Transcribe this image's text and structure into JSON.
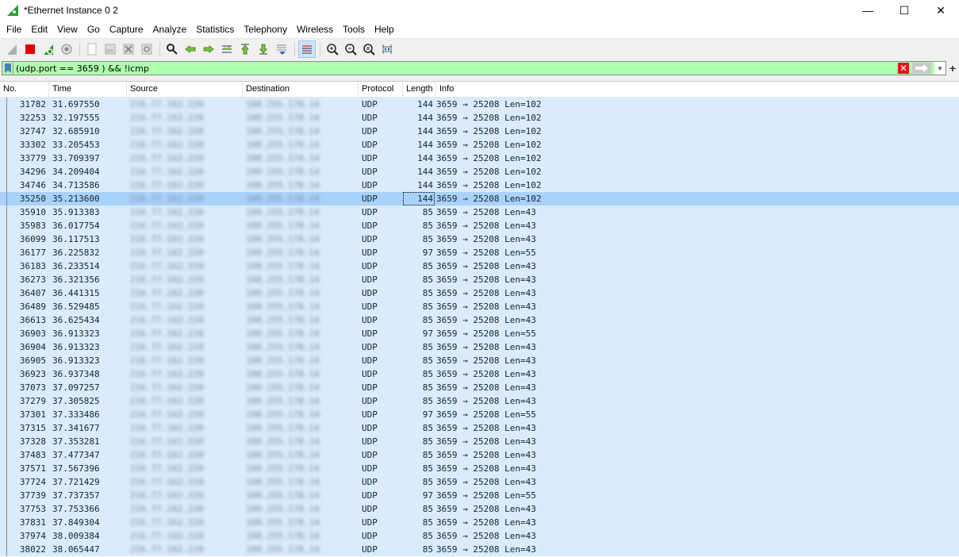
{
  "window": {
    "title": "*Ethernet Instance 0 2",
    "controls": {
      "minimize": "—",
      "maximize": "☐",
      "close": "✕"
    }
  },
  "menu": [
    "File",
    "Edit",
    "View",
    "Go",
    "Capture",
    "Analyze",
    "Statistics",
    "Telephony",
    "Wireless",
    "Tools",
    "Help"
  ],
  "toolbar": {
    "icons": [
      "shark-fin-start-icon",
      "stop-capture-icon",
      "restart-capture-icon",
      "capture-options-icon",
      "open-file-icon",
      "save-file-icon",
      "close-file-icon",
      "reload-file-icon",
      "find-packet-icon",
      "go-back-icon",
      "go-forward-icon",
      "go-to-packet-icon",
      "go-first-icon",
      "go-last-icon",
      "autoscroll-icon",
      "colorize-icon",
      "zoom-in-icon",
      "zoom-out-icon",
      "zoom-normal-icon",
      "resize-columns-icon"
    ]
  },
  "filter": {
    "value": "(udp.port == 3659 ) && !icmp",
    "valid_color": "#afffaf"
  },
  "columns": [
    "No.",
    "Time",
    "Source",
    "Destination",
    "Protocol",
    "Length",
    "Info"
  ],
  "selected_row_no": "35250",
  "packets": [
    {
      "no": "31782",
      "time": "31.697550",
      "src": "216.77.162.220",
      "dst": "100.255.178.14",
      "proto": "UDP",
      "len": "144",
      "info": "3659 → 25208 Len=102"
    },
    {
      "no": "32253",
      "time": "32.197555",
      "src": "216.77.162.220",
      "dst": "100.255.178.14",
      "proto": "UDP",
      "len": "144",
      "info": "3659 → 25208 Len=102"
    },
    {
      "no": "32747",
      "time": "32.685910",
      "src": "216.77.162.220",
      "dst": "100.255.178.14",
      "proto": "UDP",
      "len": "144",
      "info": "3659 → 25208 Len=102"
    },
    {
      "no": "33302",
      "time": "33.205453",
      "src": "216.77.162.220",
      "dst": "100.255.178.14",
      "proto": "UDP",
      "len": "144",
      "info": "3659 → 25208 Len=102"
    },
    {
      "no": "33779",
      "time": "33.709397",
      "src": "216.77.162.220",
      "dst": "100.255.178.14",
      "proto": "UDP",
      "len": "144",
      "info": "3659 → 25208 Len=102"
    },
    {
      "no": "34296",
      "time": "34.209404",
      "src": "216.77.162.220",
      "dst": "100.255.178.14",
      "proto": "UDP",
      "len": "144",
      "info": "3659 → 25208 Len=102"
    },
    {
      "no": "34746",
      "time": "34.713586",
      "src": "216.77.162.220",
      "dst": "100.255.178.14",
      "proto": "UDP",
      "len": "144",
      "info": "3659 → 25208 Len=102"
    },
    {
      "no": "35250",
      "time": "35.213600",
      "src": "216.77.162.220",
      "dst": "100.255.178.14",
      "proto": "UDP",
      "len": "144",
      "info": "3659 → 25208 Len=102"
    },
    {
      "no": "35910",
      "time": "35.913383",
      "src": "216.77.162.220",
      "dst": "100.255.178.14",
      "proto": "UDP",
      "len": "85",
      "info": "3659 → 25208 Len=43"
    },
    {
      "no": "35983",
      "time": "36.017754",
      "src": "216.77.162.220",
      "dst": "100.255.178.14",
      "proto": "UDP",
      "len": "85",
      "info": "3659 → 25208 Len=43"
    },
    {
      "no": "36099",
      "time": "36.117513",
      "src": "216.77.162.220",
      "dst": "100.255.178.14",
      "proto": "UDP",
      "len": "85",
      "info": "3659 → 25208 Len=43"
    },
    {
      "no": "36177",
      "time": "36.225832",
      "src": "216.77.162.220",
      "dst": "100.255.178.14",
      "proto": "UDP",
      "len": "97",
      "info": "3659 → 25208 Len=55"
    },
    {
      "no": "36183",
      "time": "36.233514",
      "src": "216.77.162.220",
      "dst": "100.255.178.14",
      "proto": "UDP",
      "len": "85",
      "info": "3659 → 25208 Len=43"
    },
    {
      "no": "36273",
      "time": "36.321356",
      "src": "216.77.162.220",
      "dst": "100.255.178.14",
      "proto": "UDP",
      "len": "85",
      "info": "3659 → 25208 Len=43"
    },
    {
      "no": "36407",
      "time": "36.441315",
      "src": "216.77.162.220",
      "dst": "100.255.178.14",
      "proto": "UDP",
      "len": "85",
      "info": "3659 → 25208 Len=43"
    },
    {
      "no": "36489",
      "time": "36.529485",
      "src": "216.77.162.220",
      "dst": "100.255.178.14",
      "proto": "UDP",
      "len": "85",
      "info": "3659 → 25208 Len=43"
    },
    {
      "no": "36613",
      "time": "36.625434",
      "src": "216.77.162.220",
      "dst": "100.255.178.14",
      "proto": "UDP",
      "len": "85",
      "info": "3659 → 25208 Len=43"
    },
    {
      "no": "36903",
      "time": "36.913323",
      "src": "216.77.162.220",
      "dst": "100.255.178.14",
      "proto": "UDP",
      "len": "97",
      "info": "3659 → 25208 Len=55"
    },
    {
      "no": "36904",
      "time": "36.913323",
      "src": "216.77.162.220",
      "dst": "100.255.178.14",
      "proto": "UDP",
      "len": "85",
      "info": "3659 → 25208 Len=43"
    },
    {
      "no": "36905",
      "time": "36.913323",
      "src": "216.77.162.220",
      "dst": "100.255.178.14",
      "proto": "UDP",
      "len": "85",
      "info": "3659 → 25208 Len=43"
    },
    {
      "no": "36923",
      "time": "36.937348",
      "src": "216.77.162.220",
      "dst": "100.255.178.14",
      "proto": "UDP",
      "len": "85",
      "info": "3659 → 25208 Len=43"
    },
    {
      "no": "37073",
      "time": "37.097257",
      "src": "216.77.162.220",
      "dst": "100.255.178.14",
      "proto": "UDP",
      "len": "85",
      "info": "3659 → 25208 Len=43"
    },
    {
      "no": "37279",
      "time": "37.305825",
      "src": "216.77.162.220",
      "dst": "100.255.178.14",
      "proto": "UDP",
      "len": "85",
      "info": "3659 → 25208 Len=43"
    },
    {
      "no": "37301",
      "time": "37.333486",
      "src": "216.77.162.220",
      "dst": "100.255.178.14",
      "proto": "UDP",
      "len": "97",
      "info": "3659 → 25208 Len=55"
    },
    {
      "no": "37315",
      "time": "37.341677",
      "src": "216.77.162.220",
      "dst": "100.255.178.14",
      "proto": "UDP",
      "len": "85",
      "info": "3659 → 25208 Len=43"
    },
    {
      "no": "37328",
      "time": "37.353281",
      "src": "216.77.162.220",
      "dst": "100.255.178.14",
      "proto": "UDP",
      "len": "85",
      "info": "3659 → 25208 Len=43"
    },
    {
      "no": "37483",
      "time": "37.477347",
      "src": "216.77.162.220",
      "dst": "100.255.178.14",
      "proto": "UDP",
      "len": "85",
      "info": "3659 → 25208 Len=43"
    },
    {
      "no": "37571",
      "time": "37.567396",
      "src": "216.77.162.220",
      "dst": "100.255.178.14",
      "proto": "UDP",
      "len": "85",
      "info": "3659 → 25208 Len=43"
    },
    {
      "no": "37724",
      "time": "37.721429",
      "src": "216.77.162.220",
      "dst": "100.255.178.14",
      "proto": "UDP",
      "len": "85",
      "info": "3659 → 25208 Len=43"
    },
    {
      "no": "37739",
      "time": "37.737357",
      "src": "216.77.162.220",
      "dst": "100.255.178.14",
      "proto": "UDP",
      "len": "97",
      "info": "3659 → 25208 Len=55"
    },
    {
      "no": "37753",
      "time": "37.753366",
      "src": "216.77.162.220",
      "dst": "100.255.178.14",
      "proto": "UDP",
      "len": "85",
      "info": "3659 → 25208 Len=43"
    },
    {
      "no": "37831",
      "time": "37.849304",
      "src": "216.77.162.220",
      "dst": "100.255.178.14",
      "proto": "UDP",
      "len": "85",
      "info": "3659 → 25208 Len=43"
    },
    {
      "no": "37974",
      "time": "38.009384",
      "src": "216.77.162.220",
      "dst": "100.255.178.14",
      "proto": "UDP",
      "len": "85",
      "info": "3659 → 25208 Len=43"
    },
    {
      "no": "38022",
      "time": "38.065447",
      "src": "216.77.162.220",
      "dst": "100.255.178.14",
      "proto": "UDP",
      "len": "85",
      "info": "3659 → 25208 Len=43"
    }
  ],
  "colors": {
    "row_bg": "#daebfc",
    "row_selected_bg": "#a9d2fb",
    "filter_valid": "#afffaf"
  }
}
